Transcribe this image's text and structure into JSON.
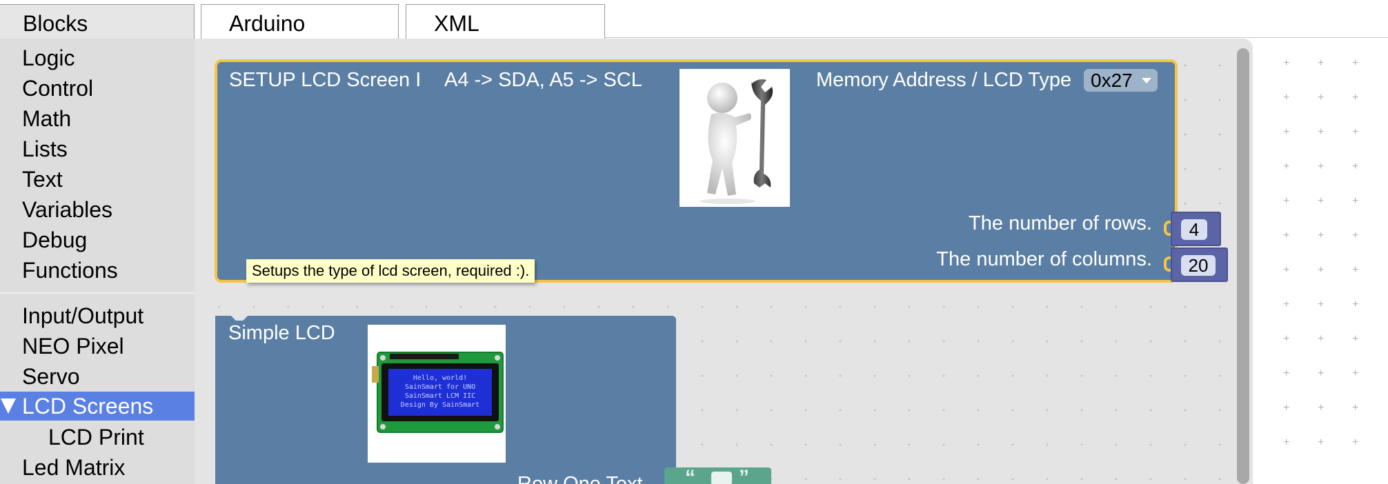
{
  "tabs": {
    "blocks": "Blocks",
    "arduino": "Arduino",
    "xml": "XML"
  },
  "toolbox": {
    "categories": [
      "Logic",
      "Control",
      "Math",
      "Lists",
      "Text",
      "Variables",
      "Debug",
      "Functions"
    ],
    "categories2": [
      "Input/Output",
      "NEO Pixel",
      "Servo"
    ],
    "selected": "LCD Screens",
    "sub_item": "LCD Print",
    "after": "Led Matrix"
  },
  "setup_block": {
    "title": "SETUP LCD Screen I",
    "pins": "A4 -> SDA, A5 -> SCL",
    "memory_label": "Memory Address / LCD Type",
    "memory_value": "0x27",
    "rows_label": "The number of rows.",
    "rows_value": "4",
    "cols_label": "The number of columns.",
    "cols_value": "20",
    "tooltip": "Setups the type of lcd screen, required :)."
  },
  "simple_block": {
    "title": "Simple LCD",
    "lcd_lines": [
      "Hello, world!",
      "SainSmart for UNO",
      "SainSmart LCM IIC",
      "Design By SainSmart"
    ],
    "row_one_label": "Row One Text"
  },
  "colors": {
    "block_blue": "#5b7fa4",
    "selected_highlight": "#f5c544",
    "toolbox_selected": "#5b80e3",
    "number_block": "#5b64a5",
    "text_block": "#5ba58c"
  }
}
